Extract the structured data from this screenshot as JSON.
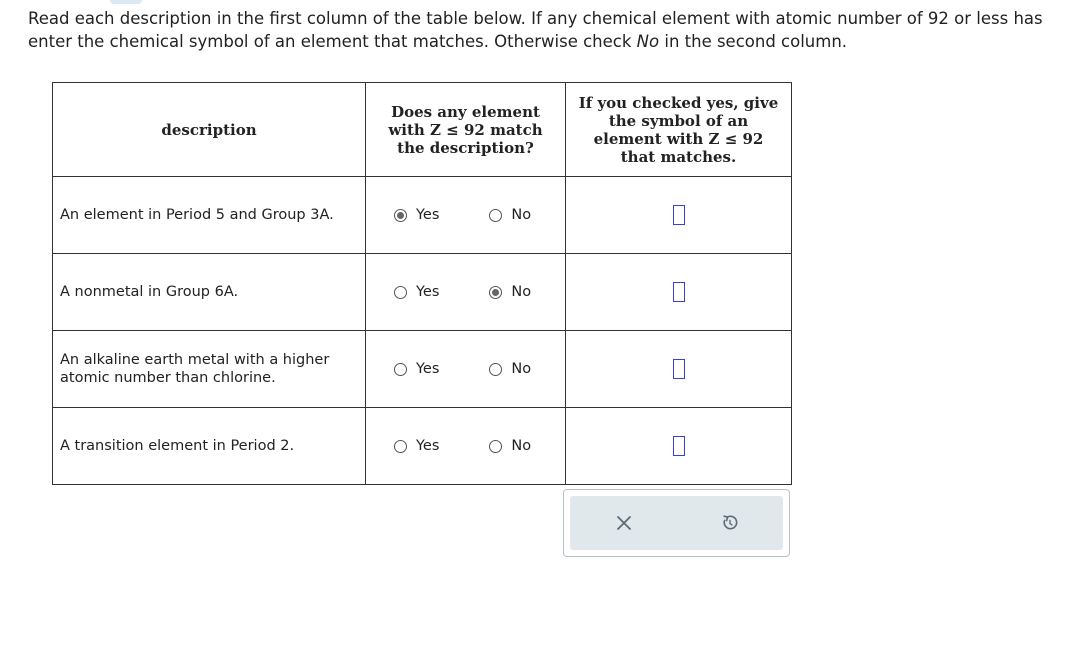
{
  "instructions": {
    "line1": "Read each description in the first column of the table below. If any chemical element with atomic number of 92 or less has",
    "line2_prefix": "enter the chemical symbol of an element that matches. Otherwise check ",
    "line2_emph": "No",
    "line2_suffix": " in the second column."
  },
  "table": {
    "headers": {
      "description": "description",
      "question_lines": [
        "Does any element",
        "with Z ≤ 92 match",
        "the description?"
      ],
      "symbol_lines": [
        "If you checked yes, give",
        "the symbol of an",
        "element with Z ≤ 92",
        "that matches."
      ]
    },
    "rows": [
      {
        "description": "An element in Period 5 and Group 3A.",
        "yes_label": "Yes",
        "no_label": "No",
        "selected": "yes",
        "symbol": ""
      },
      {
        "description": "A nonmetal in Group 6A.",
        "yes_label": "Yes",
        "no_label": "No",
        "selected": "no",
        "symbol": ""
      },
      {
        "description": "An alkaline earth metal with a higher atomic number than chlorine.",
        "yes_label": "Yes",
        "no_label": "No",
        "selected": "",
        "symbol": ""
      },
      {
        "description": "A transition element in Period 2.",
        "yes_label": "Yes",
        "no_label": "No",
        "selected": "",
        "symbol": ""
      }
    ]
  },
  "toolbar": {
    "clear_icon": "x-icon",
    "undo_icon": "undo-icon"
  },
  "colors": {
    "input_border": "#3a3fd6",
    "toolbar_bg": "#e1e8ec",
    "icon": "#5a6a7a"
  }
}
